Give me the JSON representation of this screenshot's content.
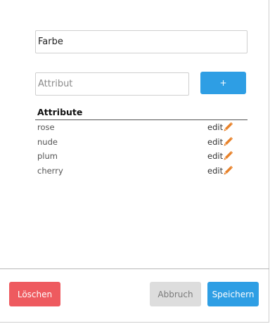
{
  "form": {
    "name_value": "Farbe",
    "attribute_placeholder": "Attribut",
    "add_label": "+"
  },
  "attributes": {
    "header": "Attribute",
    "edit_label": "edit",
    "items": [
      {
        "name": "rose"
      },
      {
        "name": "nude"
      },
      {
        "name": "plum"
      },
      {
        "name": "cherry"
      }
    ]
  },
  "footer": {
    "delete_label": "Löschen",
    "cancel_label": "Abbruch",
    "save_label": "Speichern"
  },
  "colors": {
    "primary": "#2e9ee4",
    "danger": "#ee5a5f",
    "neutral": "#dddddd",
    "pencil": "#e8822a"
  },
  "icons": {
    "edit": "pencil-icon"
  }
}
